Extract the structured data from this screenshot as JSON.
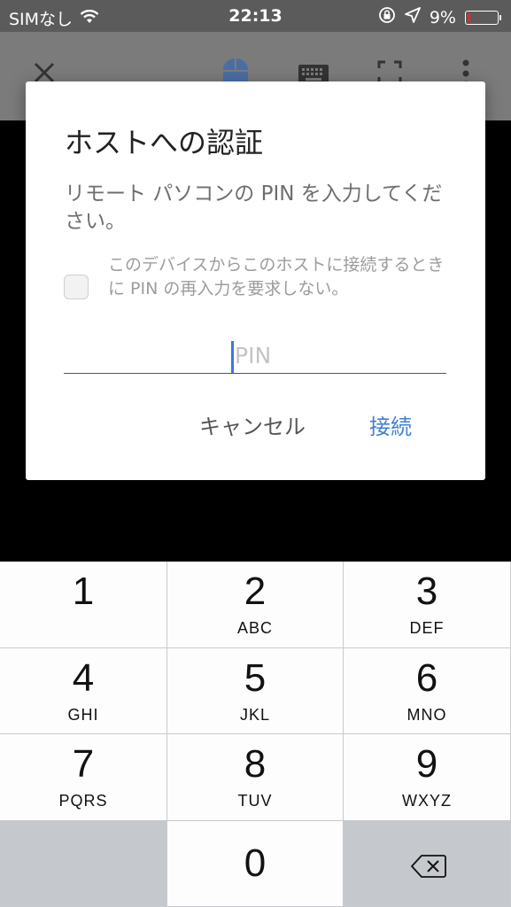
{
  "status_bar": {
    "carrier": "SIMなし",
    "time": "22:13",
    "battery_percent": "9%",
    "battery_level": 0.09,
    "battery_color": "#e4262b"
  },
  "toolbar": {
    "icons": [
      "close-icon",
      "mouse-icon",
      "keyboard-icon",
      "fullscreen-icon",
      "more-icon"
    ]
  },
  "dialog": {
    "title": "ホストへの認証",
    "message": "リモート パソコンの PIN を入力してください。",
    "checkbox_label": "このデバイスからこのホストに接続するときに PIN の再入力を要求しない。",
    "checkbox_checked": false,
    "pin_placeholder": "PIN",
    "pin_value": "",
    "cancel_label": "キャンセル",
    "connect_label": "接続",
    "accent_color": "#3f7fd0"
  },
  "keypad": {
    "keys": [
      {
        "num": "1",
        "letters": ""
      },
      {
        "num": "2",
        "letters": "ABC"
      },
      {
        "num": "3",
        "letters": "DEF"
      },
      {
        "num": "4",
        "letters": "GHI"
      },
      {
        "num": "5",
        "letters": "JKL"
      },
      {
        "num": "6",
        "letters": "MNO"
      },
      {
        "num": "7",
        "letters": "PQRS"
      },
      {
        "num": "8",
        "letters": "TUV"
      },
      {
        "num": "9",
        "letters": "WXYZ"
      },
      {
        "num": "0",
        "letters": ""
      }
    ]
  }
}
